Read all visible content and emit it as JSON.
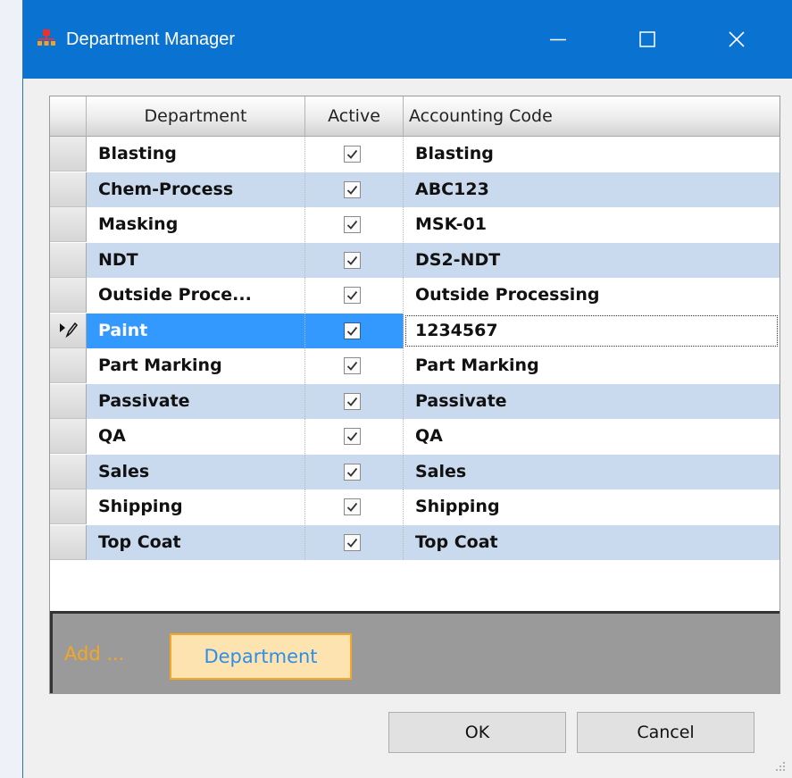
{
  "window": {
    "title": "Department Manager",
    "icon": "org-chart-icon",
    "controls": [
      "minimize-icon",
      "maximize-icon",
      "close-icon"
    ],
    "accent_color": "#0a73d1"
  },
  "grid": {
    "columns": {
      "department": "Department",
      "active": "Active",
      "accounting_code": "Accounting Code"
    },
    "rows": [
      {
        "department": "Blasting",
        "active": true,
        "accounting_code": "Blasting"
      },
      {
        "department": "Chem-Process",
        "active": true,
        "accounting_code": "ABC123"
      },
      {
        "department": "Masking",
        "active": true,
        "accounting_code": "MSK-01"
      },
      {
        "department": "NDT",
        "active": true,
        "accounting_code": "DS2-NDT"
      },
      {
        "department": "Outside Proce...",
        "active": true,
        "accounting_code": "Outside Processing"
      },
      {
        "department": "Paint",
        "active": true,
        "accounting_code": "1234567"
      },
      {
        "department": "Part Marking",
        "active": true,
        "accounting_code": "Part Marking"
      },
      {
        "department": "Passivate",
        "active": true,
        "accounting_code": "Passivate"
      },
      {
        "department": "QA",
        "active": true,
        "accounting_code": "QA"
      },
      {
        "department": "Sales",
        "active": true,
        "accounting_code": "Sales"
      },
      {
        "department": "Shipping",
        "active": true,
        "accounting_code": "Shipping"
      },
      {
        "department": "Top Coat",
        "active": true,
        "accounting_code": "Top Coat"
      }
    ],
    "current_row_index": 5,
    "row_indicator_icon": "edit-pencil-icon",
    "selection_color": "#3399ff",
    "alt_row_color": "#c9d9ee"
  },
  "add_bar": {
    "label": "Add ...",
    "button": "Department"
  },
  "buttons": {
    "ok": "OK",
    "cancel": "Cancel"
  }
}
